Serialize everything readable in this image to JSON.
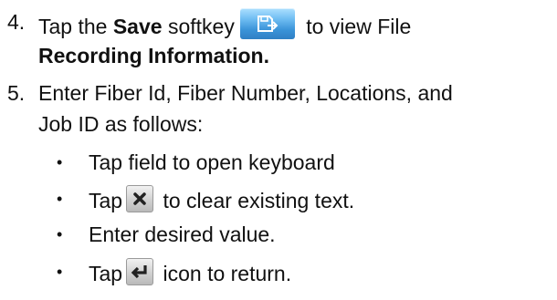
{
  "steps": [
    {
      "number": "4.",
      "pre": "Tap the ",
      "bold1": "Save",
      "mid": " softkey",
      "post": " to view File",
      "cont_bold": "Recording Information.",
      "icon": "save-softkey-icon"
    },
    {
      "number": "5.",
      "line1": "Enter Fiber Id, Fiber Number, Locations, and",
      "line2": "Job ID as follows:",
      "bullets": [
        {
          "text": "Tap field to open keyboard"
        },
        {
          "pre": "Tap",
          "icon": "clear-x-icon",
          "post": " to clear existing text."
        },
        {
          "text": "Enter desired value."
        },
        {
          "pre": "Tap",
          "icon": "return-arrow-icon",
          "post": " icon to return."
        }
      ]
    }
  ],
  "colors": {
    "save_key": "#3a93d8",
    "small_key": "#d4d4d4"
  },
  "bullet_glyph": "•"
}
